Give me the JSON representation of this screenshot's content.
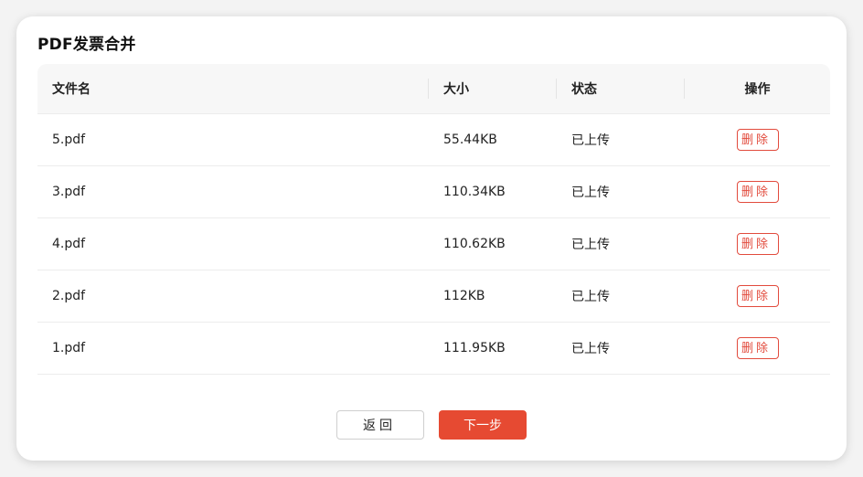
{
  "dialog": {
    "title": "PDF发票合并"
  },
  "table": {
    "headers": {
      "filename": "文件名",
      "size": "大小",
      "status": "状态",
      "action": "操作"
    },
    "rows": [
      {
        "filename": "5.pdf",
        "size": "55.44KB",
        "status": "已上传",
        "action": "删除"
      },
      {
        "filename": "3.pdf",
        "size": "110.34KB",
        "status": "已上传",
        "action": "删除"
      },
      {
        "filename": "4.pdf",
        "size": "110.62KB",
        "status": "已上传",
        "action": "删除"
      },
      {
        "filename": "2.pdf",
        "size": "112KB",
        "status": "已上传",
        "action": "删除"
      },
      {
        "filename": "1.pdf",
        "size": "111.95KB",
        "status": "已上传",
        "action": "删除"
      }
    ]
  },
  "footer": {
    "back_label": "返回",
    "next_label": "下一步"
  },
  "colors": {
    "accent": "#e64a32",
    "delete": "#e24b3d"
  }
}
